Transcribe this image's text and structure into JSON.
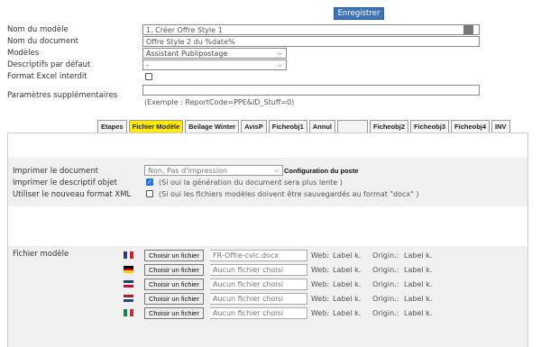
{
  "toolbar": {
    "save_label": "Enregistrer"
  },
  "form": {
    "model_name": {
      "label": "Nom du modèle",
      "value": "1. Créer Offre Style 1"
    },
    "doc_name": {
      "label": "Nom du document",
      "value": "Offre Style 2 du %date%"
    },
    "models": {
      "label": "Modèles",
      "value": "Assistant Publipostage"
    },
    "default_desc": {
      "label": "Descriptifs par défaut",
      "value": "-"
    },
    "excel_forbidden": {
      "label": "Format Excel interdit",
      "checked": false
    },
    "extra_params": {
      "label": "Paramètres supplémentaires",
      "value": "",
      "hint": "(Exemple : ReportCode=PPE&ID_Stuff=0)"
    }
  },
  "tabs": [
    {
      "label": "Etapes",
      "active": false
    },
    {
      "label": "Fichier Modèle",
      "active": true
    },
    {
      "label": "Beilage Winter",
      "active": false
    },
    {
      "label": "AvisP",
      "active": false
    },
    {
      "label": "Ficheobj1",
      "active": false
    },
    {
      "label": "Annul",
      "active": false
    },
    {
      "label": "",
      "active": false
    },
    {
      "label": "Ficheobj2",
      "active": false
    },
    {
      "label": "Ficheobj3",
      "active": false
    },
    {
      "label": "Ficheobj4",
      "active": false
    },
    {
      "label": "INV",
      "active": false
    }
  ],
  "print": {
    "print_doc": {
      "label": "Imprimer le document",
      "value": "Non, Pas d'impression",
      "config_label": "Configuration du poste"
    },
    "print_desc": {
      "label": "Imprimer le descriptif objet",
      "checked": true,
      "hint": "(Si oui la génération du document sera plus lente )"
    },
    "xml_format": {
      "label": "Utiliser le nouveau format XML",
      "checked": false,
      "hint": "(Si oui les fichiers modèles doivent être sauvegardés au format \"docx\" )"
    }
  },
  "files": {
    "label": "Fichier modèle",
    "button_label": "Choisir un fichier",
    "rows": [
      {
        "flag": "fr",
        "file": "FR-Offre-cvlc.docx",
        "web": "Web:",
        "web_val": "Label k.",
        "origin": "Origin.:",
        "origin_val": "Label k."
      },
      {
        "flag": "de",
        "file": "Aucun fichier choisi",
        "web": "Web:",
        "web_val": "Label k.",
        "origin": "Origin.:",
        "origin_val": "Label k."
      },
      {
        "flag": "uk",
        "file": "Aucun fichier choisi",
        "web": "Web:",
        "web_val": "Label k.",
        "origin": "Origin.:",
        "origin_val": "Label k."
      },
      {
        "flag": "nl",
        "file": "Aucun fichier choisi",
        "web": "Web:",
        "web_val": "Label k.",
        "origin": "Origin.:",
        "origin_val": "Label k."
      },
      {
        "flag": "it",
        "file": "Aucun fichier choisi",
        "web": "Web:",
        "web_val": "Label k.",
        "origin": "Origin.:",
        "origin_val": "Label k."
      }
    ]
  },
  "colors": {
    "save_button": "#3c74b8",
    "active_tab": "#ffea00",
    "checkbox_checked": "#1a73e8"
  }
}
